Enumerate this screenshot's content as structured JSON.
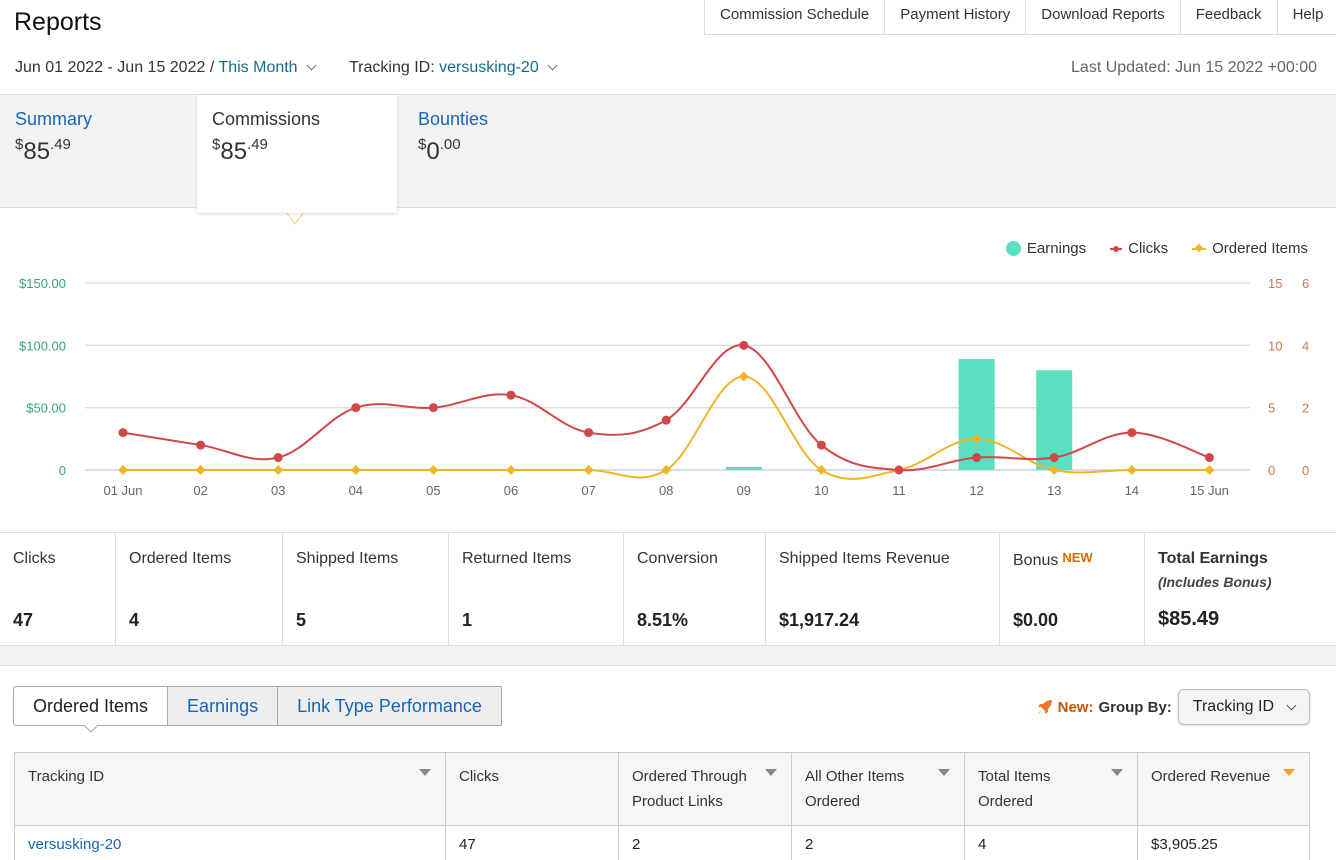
{
  "header": {
    "title": "Reports",
    "nav": [
      "Commission Schedule",
      "Payment History",
      "Download Reports",
      "Feedback",
      "Help"
    ],
    "date_range": "Jun 01 2022 - Jun 15 2022",
    "date_sep": "/",
    "period": "This Month",
    "tracking_label": "Tracking ID:",
    "tracking_id": "versusking-20",
    "last_updated": "Last Updated: Jun 15 2022 +00:00"
  },
  "summary_tabs": [
    {
      "label": "Summary",
      "dollars": "85",
      "cents": ".49"
    },
    {
      "label": "Commissions",
      "dollars": "85",
      "cents": ".49"
    },
    {
      "label": "Bounties",
      "dollars": "0",
      "cents": ".00"
    }
  ],
  "legend": [
    "Earnings",
    "Clicks",
    "Ordered Items"
  ],
  "chart_data": {
    "type": "bar+line",
    "categories": [
      "01 Jun",
      "02",
      "03",
      "04",
      "05",
      "06",
      "07",
      "08",
      "09",
      "10",
      "11",
      "12",
      "13",
      "14",
      "15 Jun"
    ],
    "series": [
      {
        "name": "Earnings",
        "type": "bar",
        "axis": "left",
        "values": [
          0,
          0,
          0,
          0,
          0,
          0,
          0,
          0,
          2.5,
          0,
          0,
          89,
          80,
          0,
          0
        ]
      },
      {
        "name": "Clicks",
        "type": "line",
        "axis": "right1",
        "values": [
          3,
          2,
          1,
          5,
          5,
          6,
          3,
          4,
          10,
          2,
          0,
          1,
          1,
          3,
          1
        ]
      },
      {
        "name": "Ordered Items",
        "type": "line",
        "axis": "right2",
        "values": [
          0,
          0,
          0,
          0,
          0,
          0,
          0,
          0,
          3,
          0,
          0,
          1,
          0,
          0,
          0
        ]
      }
    ],
    "left_ticks": [
      "0",
      "$50.00",
      "$100.00",
      "$150.00"
    ],
    "right1_ticks": [
      "0",
      "5",
      "10",
      "15"
    ],
    "right2_ticks": [
      "0",
      "2",
      "4",
      "6"
    ],
    "ylim_left": [
      0,
      150
    ],
    "ylim_right1": [
      0,
      15
    ],
    "ylim_right2": [
      0,
      6
    ],
    "colors": {
      "earnings": "#58e0c0",
      "clicks": "#d04848",
      "ordered": "#f0b429",
      "left_axis": "#3aa37a",
      "right_axis": "#c87a50"
    }
  },
  "metrics": [
    {
      "label": "Clicks",
      "value": "47"
    },
    {
      "label": "Ordered Items",
      "value": "4"
    },
    {
      "label": "Shipped Items",
      "value": "5"
    },
    {
      "label": "Returned Items",
      "value": "1"
    },
    {
      "label": "Conversion",
      "value": "8.51%"
    },
    {
      "label": "Shipped Items Revenue",
      "value": "$1,917.24"
    },
    {
      "label": "Bonus",
      "badge": "NEW",
      "value": "$0.00"
    },
    {
      "label": "Total Earnings",
      "sub": "(Includes Bonus)",
      "value": "$85.49"
    }
  ],
  "lower_tabs": [
    "Ordered Items",
    "Earnings",
    "Link Type Performance"
  ],
  "group_by": {
    "new": "New:",
    "label": "Group By:",
    "value": "Tracking ID"
  },
  "table": {
    "headers": [
      "Tracking ID",
      "Clicks",
      "Ordered Through Product Links",
      "All Other Items Ordered",
      "Total Items Ordered",
      "Ordered Revenue"
    ],
    "rows": [
      [
        "versusking-20",
        "47",
        "2",
        "2",
        "4",
        "$3,905.25"
      ]
    ]
  }
}
